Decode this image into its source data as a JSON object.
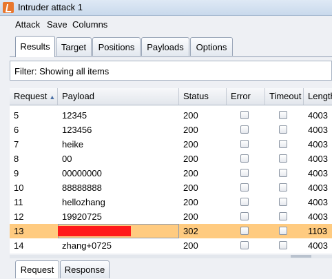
{
  "window": {
    "title": "Intruder attack 1",
    "icon": "burp-icon"
  },
  "menu": [
    "Attack",
    "Save",
    "Columns"
  ],
  "tabs": [
    "Results",
    "Target",
    "Positions",
    "Payloads",
    "Options"
  ],
  "active_tab": "Results",
  "filter": {
    "text": "Filter: Showing all items"
  },
  "table": {
    "columns": [
      "Request",
      "Payload",
      "Status",
      "Error",
      "Timeout",
      "Length"
    ],
    "columns_display": [
      "Request",
      "Payload",
      "Status",
      "Error",
      "Timeout",
      "Length"
    ],
    "sort": {
      "column": "Request",
      "direction": "ascending",
      "icon": "sort-up-icon"
    },
    "rows": [
      {
        "request": "5",
        "payload": "12345",
        "status": "200",
        "error": false,
        "timeout": false,
        "length": "4003"
      },
      {
        "request": "6",
        "payload": "123456",
        "status": "200",
        "error": false,
        "timeout": false,
        "length": "4003"
      },
      {
        "request": "7",
        "payload": "heike",
        "status": "200",
        "error": false,
        "timeout": false,
        "length": "4003"
      },
      {
        "request": "8",
        "payload": "00",
        "status": "200",
        "error": false,
        "timeout": false,
        "length": "4003"
      },
      {
        "request": "9",
        "payload": "00000000",
        "status": "200",
        "error": false,
        "timeout": false,
        "length": "4003"
      },
      {
        "request": "10",
        "payload": "88888888",
        "status": "200",
        "error": false,
        "timeout": false,
        "length": "4003"
      },
      {
        "request": "11",
        "payload": "hellozhang",
        "status": "200",
        "error": false,
        "timeout": false,
        "length": "4003"
      },
      {
        "request": "12",
        "payload": "19920725",
        "status": "200",
        "error": false,
        "timeout": false,
        "length": "4003"
      },
      {
        "request": "13",
        "payload": "",
        "status": "302",
        "error": false,
        "timeout": false,
        "length": "1103",
        "selected": true,
        "payload_redacted": true
      },
      {
        "request": "14",
        "payload": "zhang+0725",
        "status": "200",
        "error": false,
        "timeout": false,
        "length": "4003"
      }
    ]
  },
  "bottom_tabs": [
    "Request",
    "Response"
  ],
  "active_bottom_tab": "Request",
  "colors": {
    "selected_row": "#ffcb80",
    "redaction": "#ff1a1a"
  }
}
